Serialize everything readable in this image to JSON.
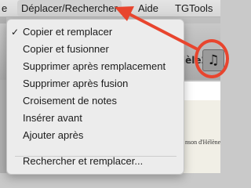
{
  "menubar": {
    "items": [
      {
        "label": "e"
      },
      {
        "label": "Déplacer/Rechercher"
      },
      {
        "label": "Aide"
      },
      {
        "label": "TGTools"
      }
    ]
  },
  "dropdown": {
    "items": [
      {
        "label": "Copier et remplacer",
        "checked": true,
        "check_mark": "✓"
      },
      {
        "label": "Copier et fusionner"
      },
      {
        "label": "Supprimer après remplacement"
      },
      {
        "label": "Supprimer après fusion"
      },
      {
        "label": "Croisement de notes"
      },
      {
        "label": "Insérer avant"
      },
      {
        "label": "Ajouter après"
      },
      {
        "label": "Rechercher et remplacer..."
      }
    ]
  },
  "background": {
    "staff_text": "lèle26",
    "paper_text": "nson d'Hélène",
    "note_button_glyph": "♫"
  },
  "colors": {
    "annotation_red": "#e8452e",
    "menu_background": "#ececec"
  },
  "icons": {
    "note_button": "music-notes-icon",
    "checkmark": "checkmark-icon",
    "annotation_arrow": "red-arrow-icon",
    "annotation_circle": "red-circle-highlight"
  }
}
